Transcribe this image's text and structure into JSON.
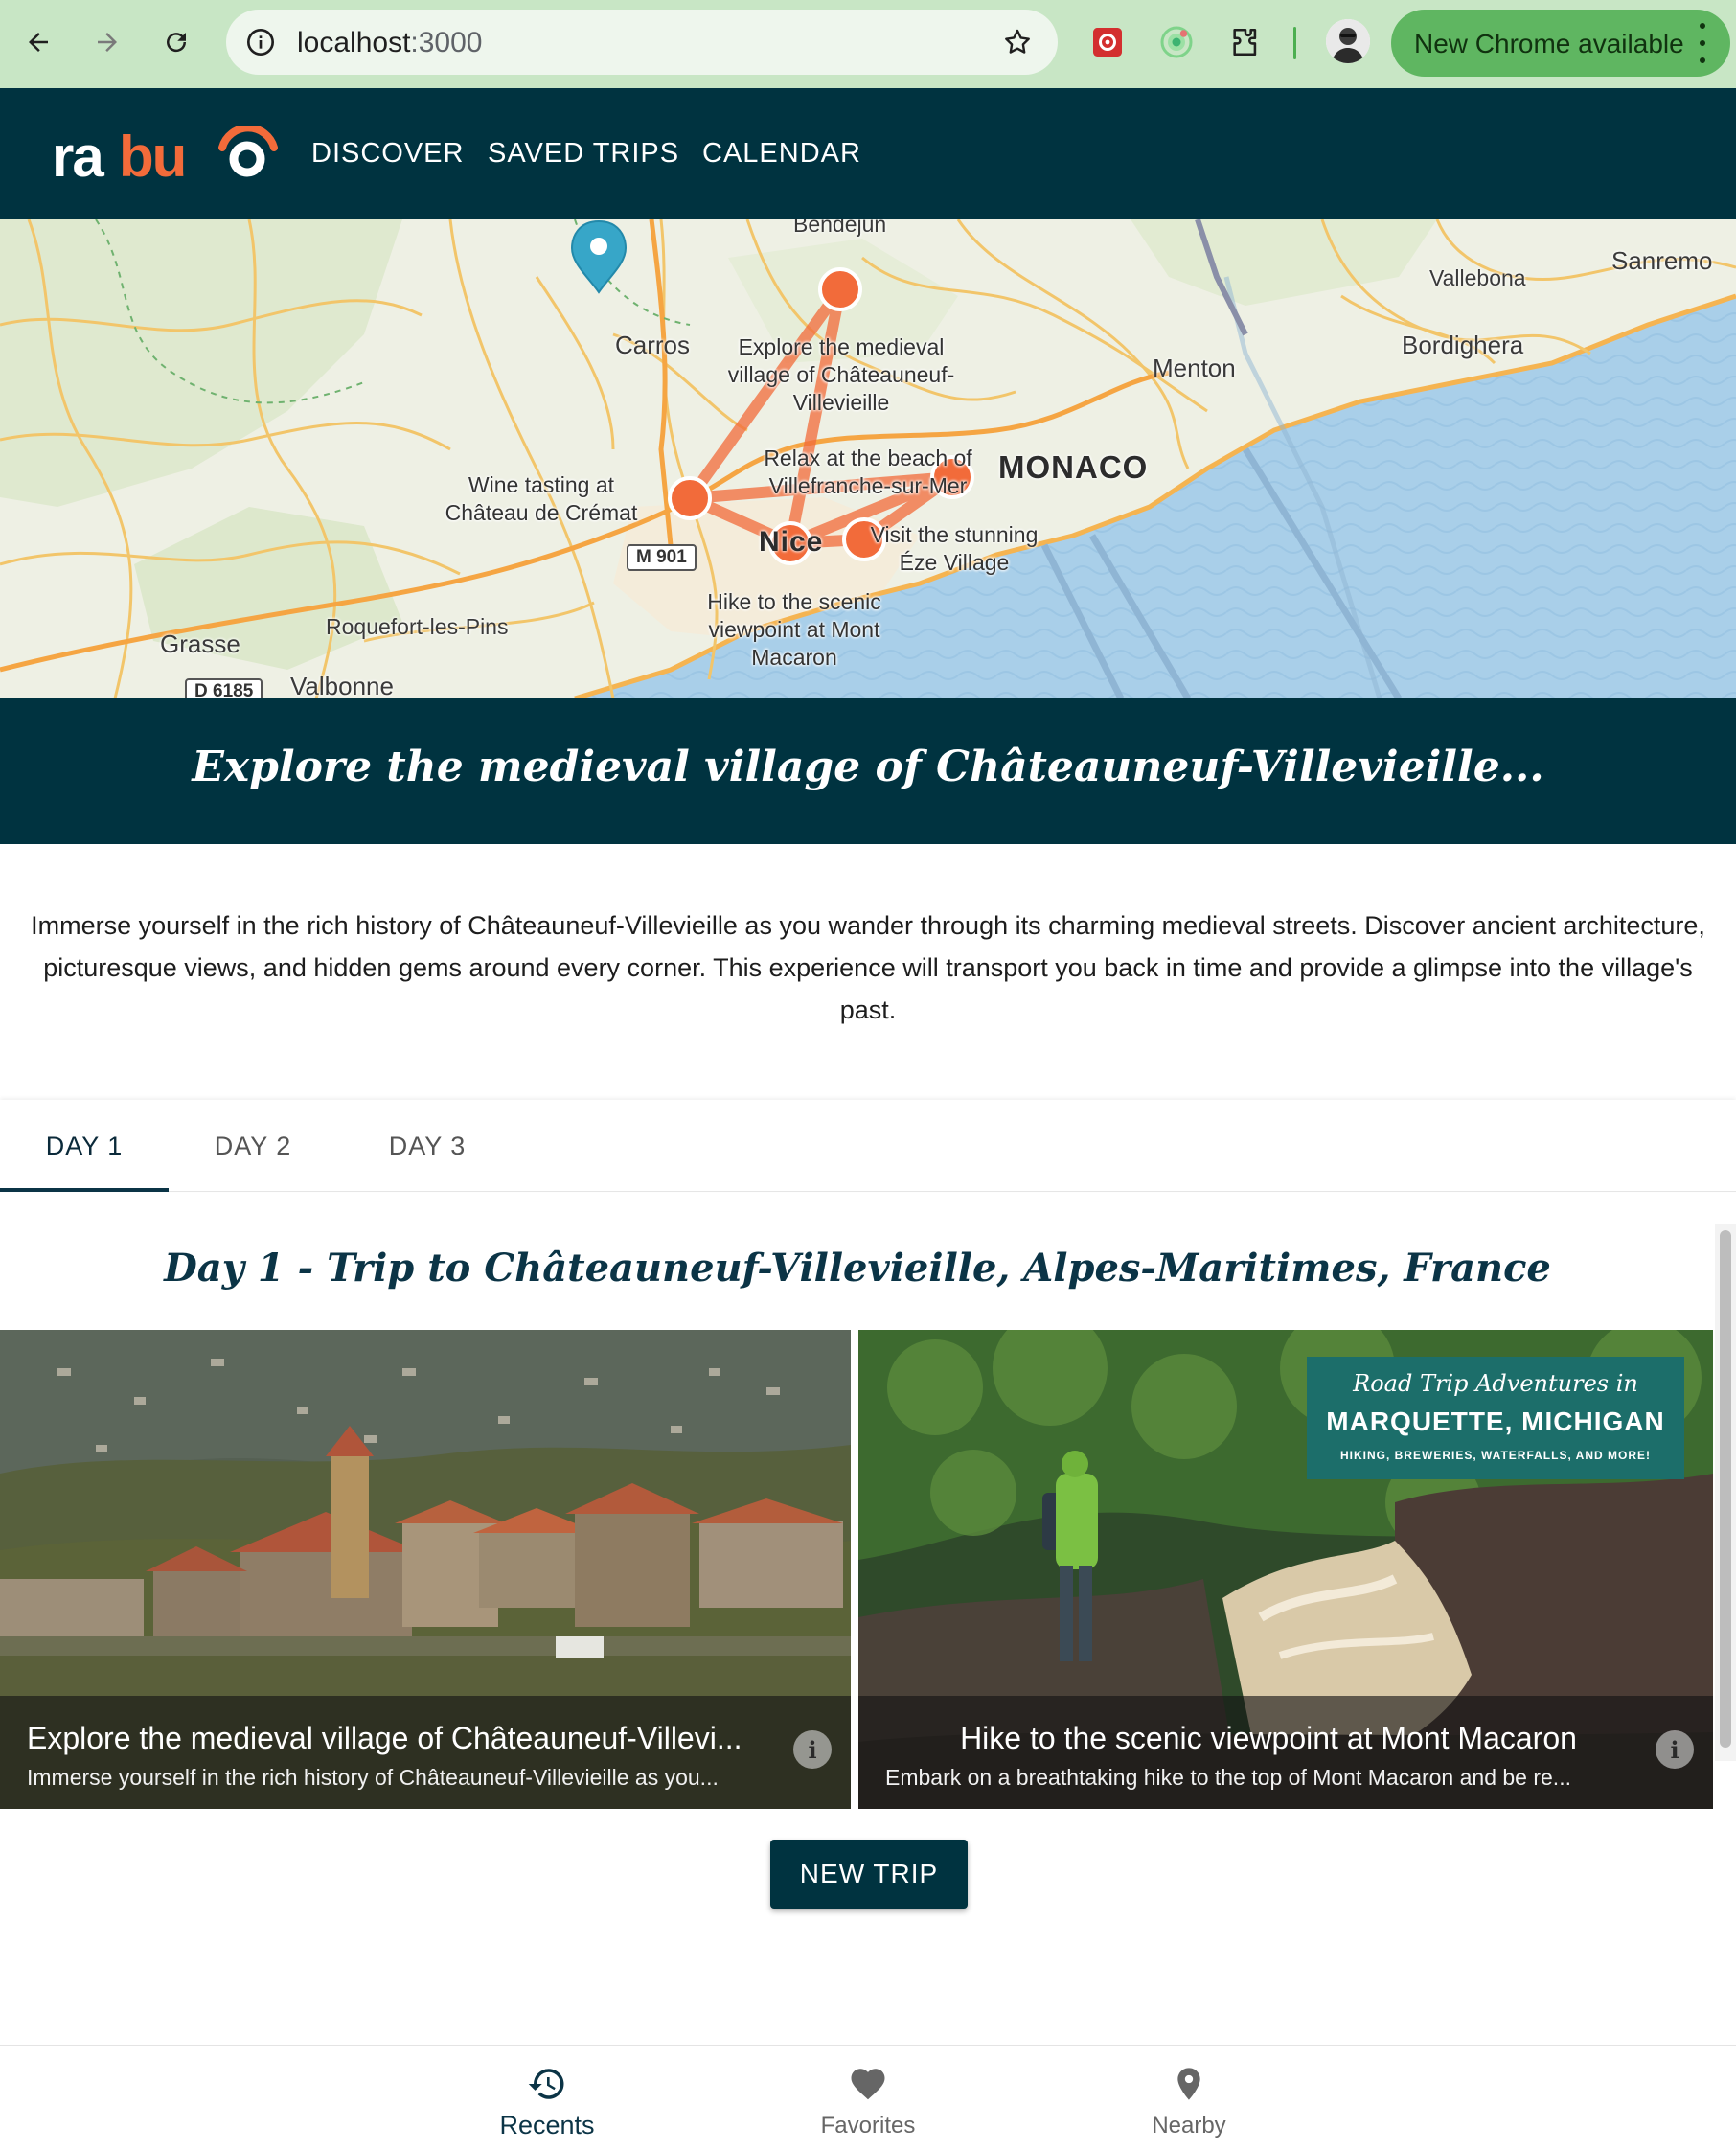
{
  "browser": {
    "url_host": "localhost",
    "url_port": ":3000",
    "update_label": "New Chrome available"
  },
  "app": {
    "logo_text": "rabuo",
    "nav": [
      "DISCOVER",
      "SAVED TRIPS",
      "CALENDAR"
    ]
  },
  "map": {
    "towns": [
      "Bendejun",
      "Carros",
      "Sanremo",
      "Vallebona",
      "Bordighera",
      "Menton",
      "Grasse",
      "Roquefort-les-Pins",
      "Valbonne",
      "Nice"
    ],
    "country_label": "MONACO",
    "roads": [
      "M 901",
      "D 6185"
    ],
    "stops": [
      "Explore the medieval village of Châteauneuf-Villevieille",
      "Relax at the beach of Villefranche-sur-Mer",
      "Wine tasting at Château de Crémat",
      "Visit the stunning Éze Village",
      "Hike to the scenic viewpoint at Mont Macaron"
    ],
    "accent_color": "#f26b3a"
  },
  "banner": {
    "title": "Explore the medieval village of Châteauneuf-Villevieille..."
  },
  "description": "Immerse yourself in the rich history of Châteauneuf-Villevieille as you wander through its charming medieval streets. Discover ancient architecture, picturesque views, and hidden gems around every corner. This experience will transport you back in time and provide a glimpse into the village's past.",
  "tabs": [
    "DAY 1",
    "DAY 2",
    "DAY 3"
  ],
  "active_tab": "DAY 1",
  "day": {
    "title": "Day 1 - Trip to Châteauneuf-Villevieille, Alpes-Maritimes, France",
    "cards": [
      {
        "title": "Explore the medieval village of Châteauneuf-Villevi...",
        "subtitle": "Immerse yourself in the rich history of Châteauneuf-Villevieille as you..."
      },
      {
        "title": "Hike to the scenic viewpoint at Mont Macaron",
        "subtitle": "Embark on a breathtaking hike to the top of Mont Macaron and be re...",
        "promo": {
          "line1": "Road Trip Adventures in",
          "line2": "MARQUETTE, MICHIGAN",
          "line3": "HIKING, BREWERIES, WATERFALLS, AND MORE!"
        }
      }
    ]
  },
  "new_trip_label": "NEW TRIP",
  "bottom_nav": {
    "items": [
      "Recents",
      "Favorites",
      "Nearby"
    ],
    "active": "Recents"
  },
  "colors": {
    "brand_dark": "#003340",
    "accent": "#f26b3a",
    "chrome_green": "#c8e6c5"
  }
}
